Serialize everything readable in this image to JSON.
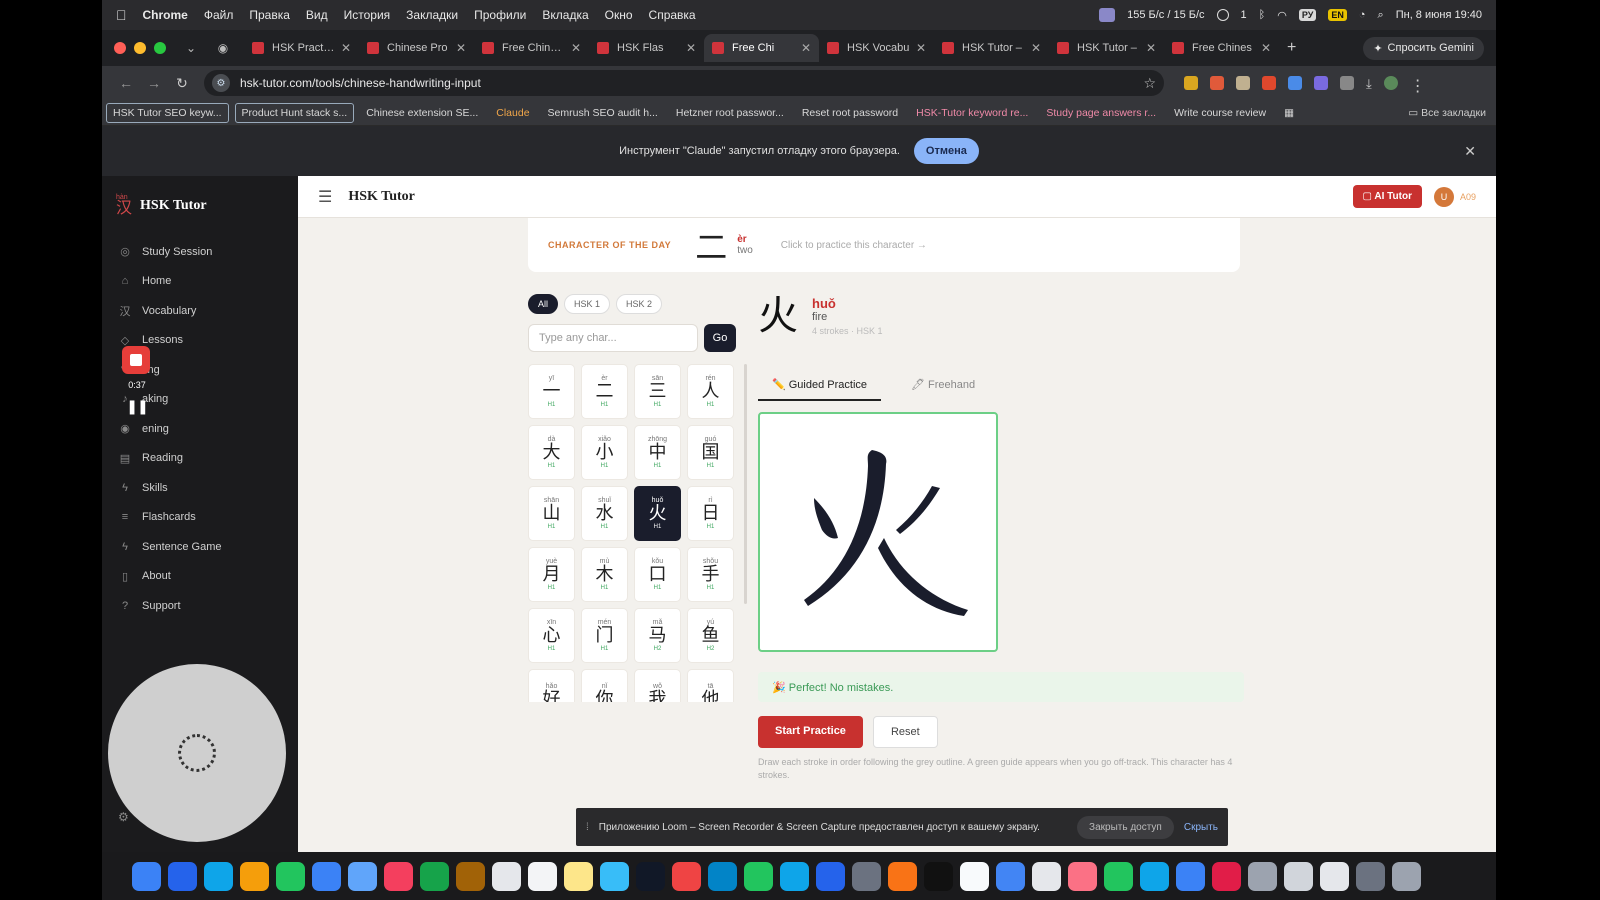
{
  "menubar": {
    "app": "Chrome",
    "items": [
      "Файл",
      "Правка",
      "Вид",
      "История",
      "Закладки",
      "Профили",
      "Вкладка",
      "Окно",
      "Справка"
    ],
    "net_stats": "155 Б/с / 15 Б/с",
    "chat_count": "1",
    "lang": "РУ",
    "battery": "EN",
    "datetime": "Пн, 8 июня 19:40"
  },
  "tabs": [
    {
      "label": "HSK Practice"
    },
    {
      "label": "Chinese Pro"
    },
    {
      "label": "Free Chinese"
    },
    {
      "label": "HSK Flas"
    },
    {
      "label": "Free Chi",
      "active": true
    },
    {
      "label": "HSK Vocabu"
    },
    {
      "label": "HSK Tutor –"
    },
    {
      "label": "HSK Tutor –"
    },
    {
      "label": "Free Chines"
    }
  ],
  "gemini": "Спросить Gemini",
  "url": "hsk-tutor.com/tools/chinese-handwriting-input",
  "bookmarks": [
    {
      "label": "HSK Tutor SEO keyw...",
      "style": "box"
    },
    {
      "label": "Product Hunt stack s...",
      "style": "box"
    },
    {
      "label": "Chinese extension SE...",
      "style": ""
    },
    {
      "label": "Claude",
      "style": "orange"
    },
    {
      "label": "Semrush SEO audit h...",
      "style": ""
    },
    {
      "label": "Hetzner root passwor...",
      "style": ""
    },
    {
      "label": "Reset root password",
      "style": ""
    },
    {
      "label": "HSK-Tutor keyword re...",
      "style": "pink"
    },
    {
      "label": "Study page answers r...",
      "style": "pink"
    },
    {
      "label": "Write course review",
      "style": ""
    }
  ],
  "all_bookmarks": "Все закладки",
  "infobar": {
    "message": "Инструмент \"Claude\" запустил отладку этого браузера.",
    "cancel": "Отмена"
  },
  "sidebar": {
    "brand": "HSK Tutor",
    "logo_pinyin": "hàn",
    "logo_char": "汉",
    "items": [
      {
        "label": "Study Session",
        "icon": "◎"
      },
      {
        "label": "Home",
        "icon": "⌂"
      },
      {
        "label": "Vocabulary",
        "icon": "汉"
      },
      {
        "label": "Lessons",
        "icon": "◇"
      },
      {
        "label": "ting",
        "icon": "✎"
      },
      {
        "label": "aking",
        "icon": "♪"
      },
      {
        "label": "ening",
        "icon": "◉"
      },
      {
        "label": "Reading",
        "icon": "▤"
      },
      {
        "label": "Skills",
        "icon": "ϟ"
      },
      {
        "label": "Flashcards",
        "icon": "≡"
      },
      {
        "label": "Sentence Game",
        "icon": "ϟ"
      },
      {
        "label": "About",
        "icon": "▯"
      },
      {
        "label": "Support",
        "icon": "?"
      }
    ],
    "rec_time": "0:37"
  },
  "topbar": {
    "title": "HSK Tutor",
    "ai_tutor": "AI Tutor",
    "avatar": "U",
    "lang": "A09"
  },
  "cotd": {
    "label": "CHARACTER OF THE DAY",
    "char": "二",
    "pinyin": "èr",
    "meaning": "two",
    "hint": "Click to practice this character →"
  },
  "filters": [
    "All",
    "HSK 1",
    "HSK 2"
  ],
  "search": {
    "placeholder": "Type any char...",
    "go": "Go"
  },
  "characters": [
    {
      "py": "yī",
      "ch": "一",
      "lv": "H1"
    },
    {
      "py": "èr",
      "ch": "二",
      "lv": "H1"
    },
    {
      "py": "sān",
      "ch": "三",
      "lv": "H1"
    },
    {
      "py": "rén",
      "ch": "人",
      "lv": "H1"
    },
    {
      "py": "dà",
      "ch": "大",
      "lv": "H1"
    },
    {
      "py": "xiǎo",
      "ch": "小",
      "lv": "H1"
    },
    {
      "py": "zhōng",
      "ch": "中",
      "lv": "H1"
    },
    {
      "py": "guó",
      "ch": "国",
      "lv": "H1"
    },
    {
      "py": "shān",
      "ch": "山",
      "lv": "H1"
    },
    {
      "py": "shuǐ",
      "ch": "水",
      "lv": "H1"
    },
    {
      "py": "huǒ",
      "ch": "火",
      "lv": "H1",
      "selected": true
    },
    {
      "py": "rì",
      "ch": "日",
      "lv": "H1"
    },
    {
      "py": "yuè",
      "ch": "月",
      "lv": "H1"
    },
    {
      "py": "mù",
      "ch": "木",
      "lv": "H1"
    },
    {
      "py": "kǒu",
      "ch": "口",
      "lv": "H1"
    },
    {
      "py": "shǒu",
      "ch": "手",
      "lv": "H1"
    },
    {
      "py": "xīn",
      "ch": "心",
      "lv": "H1"
    },
    {
      "py": "mén",
      "ch": "门",
      "lv": "H1"
    },
    {
      "py": "mǎ",
      "ch": "马",
      "lv": "H2"
    },
    {
      "py": "yú",
      "ch": "鱼",
      "lv": "H2"
    },
    {
      "py": "hǎo",
      "ch": "好",
      "lv": ""
    },
    {
      "py": "nǐ",
      "ch": "你",
      "lv": ""
    },
    {
      "py": "wǒ",
      "ch": "我",
      "lv": ""
    },
    {
      "py": "tā",
      "ch": "他",
      "lv": ""
    }
  ],
  "detail": {
    "char": "火",
    "pinyin": "huǒ",
    "meaning": "fire",
    "strokes": "4 strokes · HSK 1"
  },
  "practice_tabs": [
    "✏️ Guided Practice",
    "🖊 Freehand"
  ],
  "feedback": "🎉 Perfect! No mistakes.",
  "buttons": {
    "start": "Start Practice",
    "reset": "Reset"
  },
  "instructions": "Draw each stroke in order following the grey outline. A green guide appears when you go off-track. This character has 4 strokes.",
  "loom": {
    "message": "Приложению Loom – Screen Recorder & Screen Capture предоставлен доступ к вашему экрану.",
    "revoke": "Закрыть доступ",
    "hide": "Скрыть"
  },
  "dock_colors": [
    "#3b82f6",
    "#2563eb",
    "#0ea5e9",
    "#f59e0b",
    "#22c55e",
    "#3b82f6",
    "#60a5fa",
    "#f43f5e",
    "#16a34a",
    "#a16207",
    "#e5e7eb",
    "#f3f4f6",
    "#fde68a",
    "#38bdf8",
    "#111827",
    "#ef4444",
    "#0284c7",
    "#22c55e",
    "#0ea5e9",
    "#2563eb",
    "#6b7280",
    "#f97316",
    "#111111",
    "#f8fafc",
    "#4285f4",
    "#e5e7eb",
    "#fb7185",
    "#22c55e",
    "#0ea5e9",
    "#3b82f6",
    "#e11d48",
    "#9ca3af",
    "#d1d5db",
    "#e5e7eb",
    "#6b7280",
    "#9ca3af"
  ]
}
